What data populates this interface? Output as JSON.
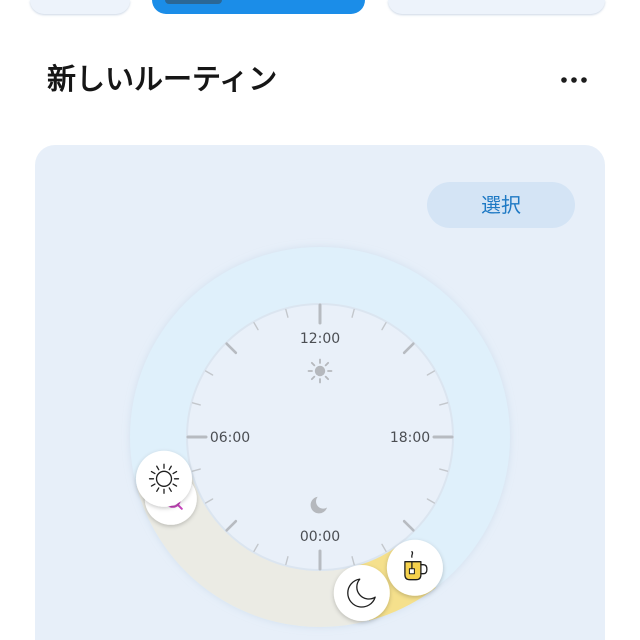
{
  "header": {
    "title": "新しいルーティン",
    "more_icon": "more-horizontal-icon"
  },
  "panel": {
    "select_button": "選択",
    "clock": {
      "labels": {
        "top": "12:00",
        "left": "06:00",
        "right": "18:00",
        "bottom": "00:00"
      },
      "day_icon": "sun-icon",
      "night_icon": "moon-icon",
      "segments": [
        {
          "from_hour": 23,
          "to_hour": 5,
          "color": "#ebebe4"
        },
        {
          "from_hour": 21.5,
          "to_hour": 23,
          "color": "#f5e08c"
        }
      ],
      "handles": [
        {
          "icon": "sunrise-icon",
          "hour": 4.5
        },
        {
          "icon": "sun-icon",
          "hour": 5
        },
        {
          "icon": "tea-mug-icon",
          "hour": 21.6
        },
        {
          "icon": "moon-icon",
          "hour": 23
        }
      ]
    }
  },
  "colors": {
    "accent": "#1b8de8",
    "panel_background": "#e7eff9",
    "ring": "#dff0fb",
    "select_text": "#1e79c4"
  }
}
